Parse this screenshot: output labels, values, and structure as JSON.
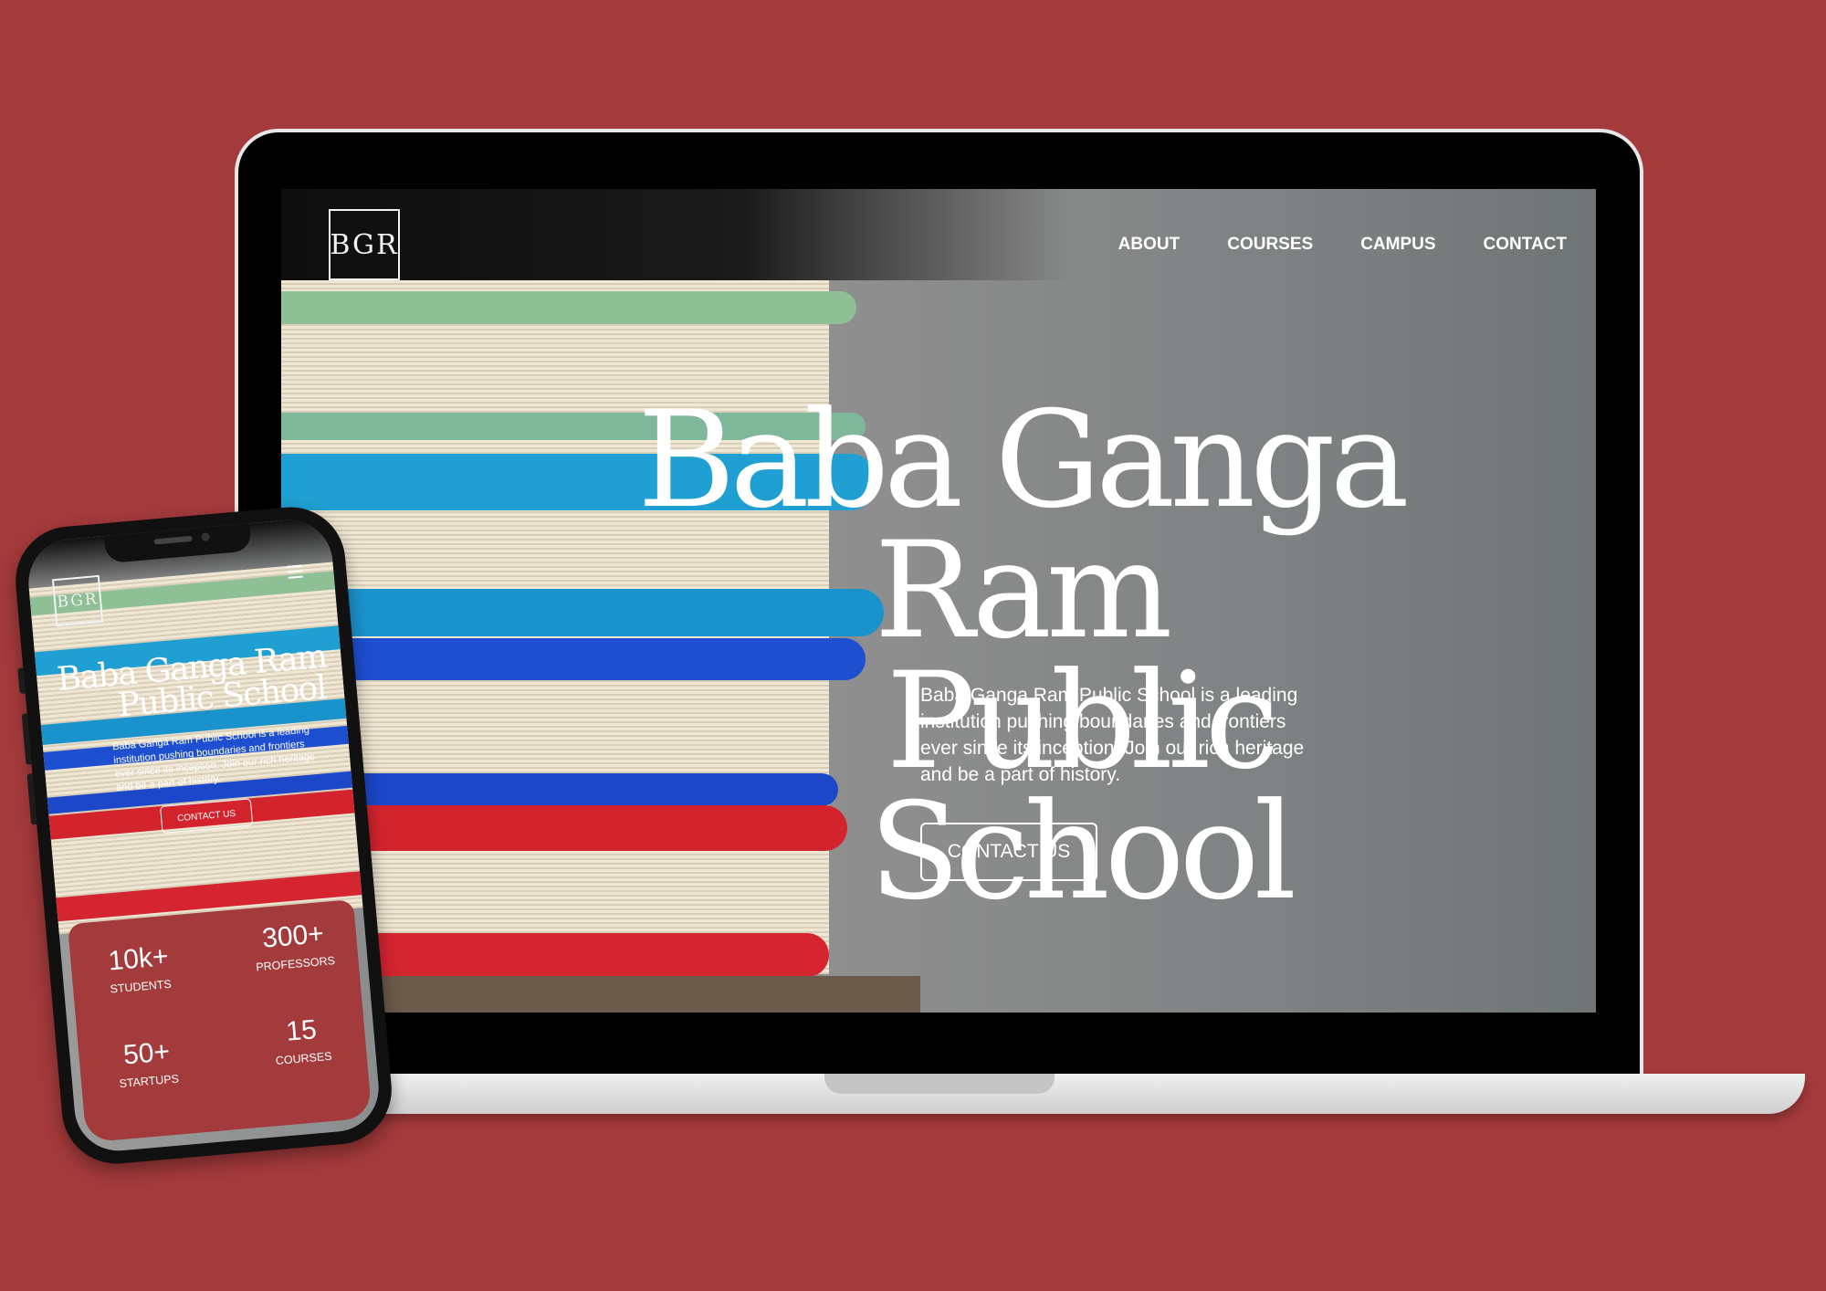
{
  "brand": {
    "logo_text": "BGR"
  },
  "nav": {
    "items": [
      "ABOUT",
      "COURSES",
      "CAMPUS",
      "CONTACT"
    ]
  },
  "hero": {
    "title_line1": "Baba Ganga Ram",
    "title_line2": "Public School",
    "description": "Baba Ganga Ram Public School is a leading institution pushing boundaries and frontiers ever since its inception. Join our rich heritage and be a part of history.",
    "cta_label": "CONTACT US"
  },
  "stats": [
    {
      "value": "10k+",
      "label": "STUDENTS"
    },
    {
      "value": "300+",
      "label": "PROFESSORS"
    },
    {
      "value": "50+",
      "label": "STARTUPS"
    },
    {
      "value": "15",
      "label": "COURSES"
    }
  ],
  "colors": {
    "background": "#a33a3b",
    "accent_red": "#a33a3b",
    "text_light": "#ffffff"
  },
  "icons": {
    "menu": "hamburger-icon"
  }
}
